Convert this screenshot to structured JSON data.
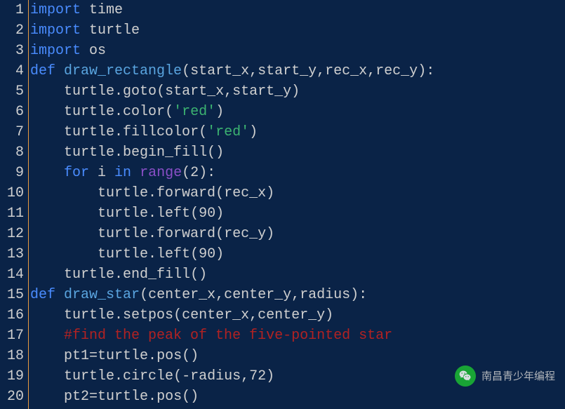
{
  "lines": [
    {
      "n": "1",
      "tokens": [
        [
          "kw",
          "import"
        ],
        [
          "txt",
          " "
        ],
        [
          "mod",
          "time"
        ]
      ]
    },
    {
      "n": "2",
      "tokens": [
        [
          "kw",
          "import"
        ],
        [
          "txt",
          " "
        ],
        [
          "mod",
          "turtle"
        ]
      ]
    },
    {
      "n": "3",
      "tokens": [
        [
          "kw",
          "import"
        ],
        [
          "txt",
          " "
        ],
        [
          "mod",
          "os"
        ]
      ]
    },
    {
      "n": "4",
      "tokens": [
        [
          "def",
          "def"
        ],
        [
          "txt",
          " "
        ],
        [
          "fname",
          "draw_rectangle"
        ],
        [
          "punct",
          "("
        ],
        [
          "txt",
          "start_x"
        ],
        [
          "punct",
          ","
        ],
        [
          "txt",
          "start_y"
        ],
        [
          "punct",
          ","
        ],
        [
          "txt",
          "rec_x"
        ],
        [
          "punct",
          ","
        ],
        [
          "txt",
          "rec_y"
        ],
        [
          "punct",
          ")"
        ],
        [
          "punct",
          ":"
        ]
      ]
    },
    {
      "n": "5",
      "tokens": [
        [
          "txt",
          "    turtle"
        ],
        [
          "punct",
          "."
        ],
        [
          "txt",
          "goto"
        ],
        [
          "punct",
          "("
        ],
        [
          "txt",
          "start_x"
        ],
        [
          "punct",
          ","
        ],
        [
          "txt",
          "start_y"
        ],
        [
          "punct",
          ")"
        ]
      ]
    },
    {
      "n": "6",
      "tokens": [
        [
          "txt",
          "    turtle"
        ],
        [
          "punct",
          "."
        ],
        [
          "txt",
          "color"
        ],
        [
          "punct",
          "("
        ],
        [
          "str",
          "'red'"
        ],
        [
          "punct",
          ")"
        ]
      ]
    },
    {
      "n": "7",
      "tokens": [
        [
          "txt",
          "    turtle"
        ],
        [
          "punct",
          "."
        ],
        [
          "txt",
          "fillcolor"
        ],
        [
          "punct",
          "("
        ],
        [
          "str",
          "'red'"
        ],
        [
          "punct",
          ")"
        ]
      ]
    },
    {
      "n": "8",
      "tokens": [
        [
          "txt",
          "    turtle"
        ],
        [
          "punct",
          "."
        ],
        [
          "txt",
          "begin_fill"
        ],
        [
          "punct",
          "("
        ],
        [
          "punct",
          ")"
        ]
      ]
    },
    {
      "n": "9",
      "tokens": [
        [
          "txt",
          "    "
        ],
        [
          "kw",
          "for"
        ],
        [
          "txt",
          " i "
        ],
        [
          "kw",
          "in"
        ],
        [
          "txt",
          " "
        ],
        [
          "builtin",
          "range"
        ],
        [
          "punct",
          "("
        ],
        [
          "txt",
          "2"
        ],
        [
          "punct",
          ")"
        ],
        [
          "punct",
          ":"
        ]
      ]
    },
    {
      "n": "10",
      "tokens": [
        [
          "txt",
          "        turtle"
        ],
        [
          "punct",
          "."
        ],
        [
          "txt",
          "forward"
        ],
        [
          "punct",
          "("
        ],
        [
          "txt",
          "rec_x"
        ],
        [
          "punct",
          ")"
        ]
      ]
    },
    {
      "n": "11",
      "tokens": [
        [
          "txt",
          "        turtle"
        ],
        [
          "punct",
          "."
        ],
        [
          "txt",
          "left"
        ],
        [
          "punct",
          "("
        ],
        [
          "txt",
          "90"
        ],
        [
          "punct",
          ")"
        ]
      ]
    },
    {
      "n": "12",
      "tokens": [
        [
          "txt",
          "        turtle"
        ],
        [
          "punct",
          "."
        ],
        [
          "txt",
          "forward"
        ],
        [
          "punct",
          "("
        ],
        [
          "txt",
          "rec_y"
        ],
        [
          "punct",
          ")"
        ]
      ]
    },
    {
      "n": "13",
      "tokens": [
        [
          "txt",
          "        turtle"
        ],
        [
          "punct",
          "."
        ],
        [
          "txt",
          "left"
        ],
        [
          "punct",
          "("
        ],
        [
          "txt",
          "90"
        ],
        [
          "punct",
          ")"
        ]
      ]
    },
    {
      "n": "14",
      "tokens": [
        [
          "txt",
          "    turtle"
        ],
        [
          "punct",
          "."
        ],
        [
          "txt",
          "end_fill"
        ],
        [
          "punct",
          "("
        ],
        [
          "punct",
          ")"
        ]
      ]
    },
    {
      "n": "15",
      "tokens": [
        [
          "def",
          "def"
        ],
        [
          "txt",
          " "
        ],
        [
          "fname",
          "draw_star"
        ],
        [
          "punct",
          "("
        ],
        [
          "txt",
          "center_x"
        ],
        [
          "punct",
          ","
        ],
        [
          "txt",
          "center_y"
        ],
        [
          "punct",
          ","
        ],
        [
          "txt",
          "radius"
        ],
        [
          "punct",
          ")"
        ],
        [
          "punct",
          ":"
        ]
      ]
    },
    {
      "n": "16",
      "tokens": [
        [
          "txt",
          "    turtle"
        ],
        [
          "punct",
          "."
        ],
        [
          "txt",
          "setpos"
        ],
        [
          "punct",
          "("
        ],
        [
          "txt",
          "center_x"
        ],
        [
          "punct",
          ","
        ],
        [
          "txt",
          "center_y"
        ],
        [
          "punct",
          ")"
        ]
      ]
    },
    {
      "n": "17",
      "tokens": [
        [
          "txt",
          "    "
        ],
        [
          "comment",
          "#find the peak of the five-pointed star"
        ]
      ]
    },
    {
      "n": "18",
      "tokens": [
        [
          "txt",
          "    pt1"
        ],
        [
          "op",
          "="
        ],
        [
          "txt",
          "turtle"
        ],
        [
          "punct",
          "."
        ],
        [
          "txt",
          "pos"
        ],
        [
          "punct",
          "("
        ],
        [
          "punct",
          ")"
        ]
      ]
    },
    {
      "n": "19",
      "tokens": [
        [
          "txt",
          "    turtle"
        ],
        [
          "punct",
          "."
        ],
        [
          "txt",
          "circle"
        ],
        [
          "punct",
          "("
        ],
        [
          "op",
          "-"
        ],
        [
          "txt",
          "radius"
        ],
        [
          "punct",
          ","
        ],
        [
          "txt",
          "72"
        ],
        [
          "punct",
          ")"
        ]
      ]
    },
    {
      "n": "20",
      "tokens": [
        [
          "txt",
          "    pt2"
        ],
        [
          "op",
          "="
        ],
        [
          "txt",
          "turtle"
        ],
        [
          "punct",
          "."
        ],
        [
          "txt",
          "pos"
        ],
        [
          "punct",
          "("
        ],
        [
          "punct",
          ")"
        ]
      ]
    }
  ],
  "watermark": "南昌青少年编程"
}
